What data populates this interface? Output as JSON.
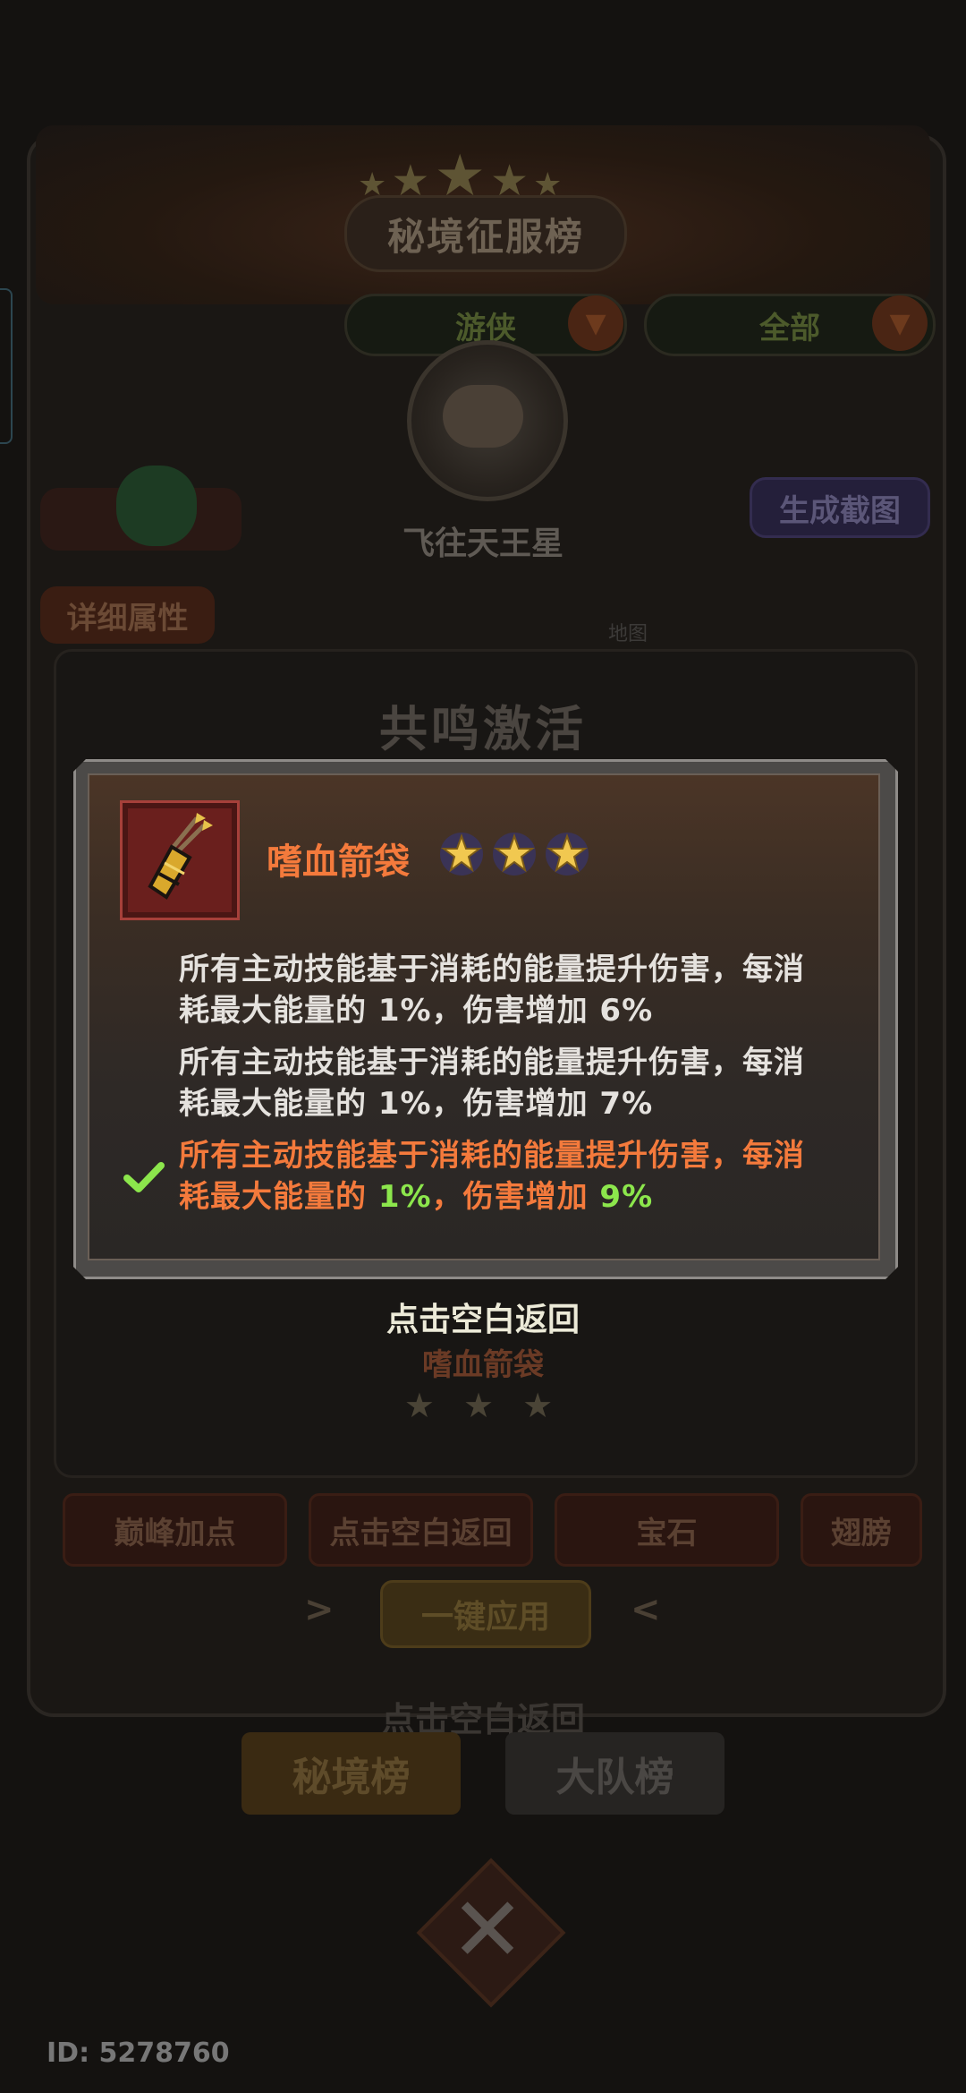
{
  "background": {
    "leaderboard_title": "秘境征服榜",
    "class_dropdown": "游侠",
    "scope_dropdown": "全部",
    "player_name": "飞往天王星",
    "screenshot_button": "生成截图",
    "detail_tab": "详细属性",
    "resonance_title": "共鸣激活",
    "tabs": [
      "巅峰加点",
      "点击空白返回",
      "宝石",
      "翅膀"
    ],
    "apply_button": "一键应用",
    "faint_return": "点击空白返回",
    "bottom_tabs": [
      "秘境榜",
      "大队榜"
    ],
    "under_item_name": "嗜血箭袋",
    "under_item_stars": "★ ★ ★",
    "side_label": "地图"
  },
  "popup": {
    "item_name": "嗜血箭袋",
    "item_icon": "quiver-icon",
    "star_count": 3,
    "lines": [
      {
        "prefix": "所有主动技能基于消耗的能量提升伤害，每消",
        "line2_a": "耗最大能量的 ",
        "pct": "1%",
        "line2_b": "，伤害增加 ",
        "bonus": "6%",
        "active": false
      },
      {
        "prefix": "所有主动技能基于消耗的能量提升伤害，每消",
        "line2_a": "耗最大能量的 ",
        "pct": "1%",
        "line2_b": "，伤害增加 ",
        "bonus": "7%",
        "active": false
      },
      {
        "prefix": "所有主动技能基于消耗的能量提升伤害，每消",
        "line2_a": "耗最大能量的 ",
        "pct": "1%",
        "line2_b": "，伤害增加 ",
        "bonus": "9%",
        "active": true
      }
    ],
    "return_hint": "点击空白返回"
  },
  "footer": {
    "id_label": "ID: 5278760"
  },
  "colors": {
    "accent_orange": "#f47a3c",
    "highlight_green": "#8ce64c",
    "item_frame": "#a6403a"
  }
}
